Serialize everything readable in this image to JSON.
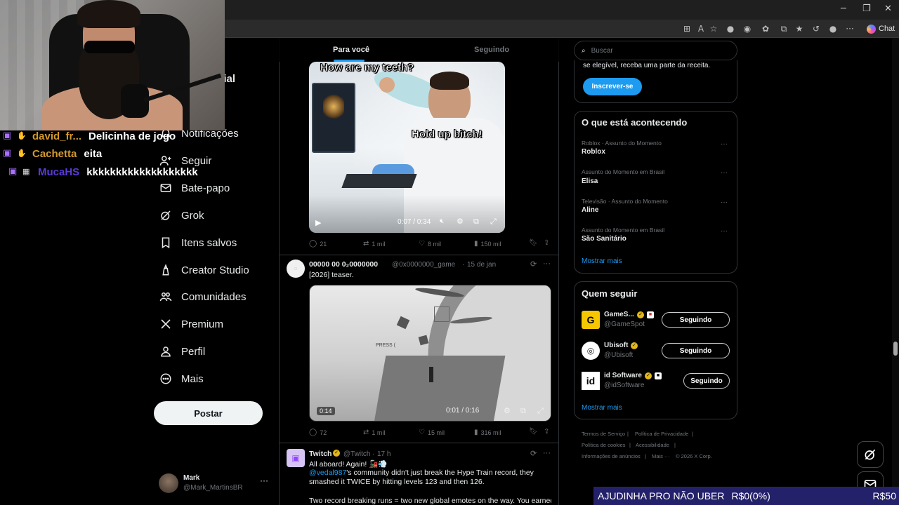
{
  "stream_overlay": {
    "chat": [
      {
        "user": "david_fr...",
        "user_color": "#d49a2f",
        "message": "Delicinha de jogo"
      },
      {
        "user": "Cachetta",
        "user_color": "#d49a2f",
        "message": "eita"
      },
      {
        "user": "MucaHS",
        "user_color": "#5b3bd9",
        "message": "kkkkkkkkkkkkkkkkkkk"
      }
    ],
    "donation_bar": {
      "label": "AJUDINHA PRO NÃO UBER",
      "current": "R$0(0%)",
      "goal": "R$50"
    }
  },
  "browser": {
    "chat_button": "Chat"
  },
  "nav": {
    "partial_item": "cial",
    "items": [
      {
        "label": "Notificações"
      },
      {
        "label": "Seguir"
      },
      {
        "label": "Bate-papo"
      },
      {
        "label": "Grok"
      },
      {
        "label": "Itens salvos"
      },
      {
        "label": "Creator Studio"
      },
      {
        "label": "Comunidades"
      },
      {
        "label": "Premium"
      },
      {
        "label": "Perfil"
      },
      {
        "label": "Mais"
      }
    ],
    "post_button": "Postar",
    "account": {
      "name": "Mark",
      "handle": "@Mark_MartinsBR"
    }
  },
  "timeline": {
    "tabs": [
      "Para você",
      "Seguindo"
    ],
    "posts": [
      {
        "meme_top": "How are my teeth?",
        "meme_bottom": "Hold up bitch!",
        "video_time": "0:07 / 0:34",
        "stats": {
          "replies": "21",
          "reposts": "1 mil",
          "likes": "8 mil",
          "views": "150 mil"
        }
      },
      {
        "author": "00000 00 0₂0000000",
        "handle": "@0x0000000_game",
        "date": "15 de jan",
        "text": "[2026] teaser.",
        "video_badge": "0:14",
        "video_time": "0:01 / 0:16",
        "scene_text": "PRESS (",
        "stats": {
          "replies": "72",
          "reposts": "1 mil",
          "likes": "15 mil",
          "views": "316 mil"
        }
      },
      {
        "author": "Twitch",
        "handle": "@Twitch",
        "time": "17 h",
        "line1": "All aboard! Again! 🚂💨",
        "mention": "@vedal987",
        "line2": "'s community didn't just break the Hype Train record, they smashed it TWICE by hitting levels 123 and then 126.",
        "line3": "Two record breaking runs = two new global emotes on the way. You earned"
      }
    ]
  },
  "sidebar": {
    "search_placeholder": "Buscar",
    "premium_text": "se elegível, receba uma parte da receita.",
    "subscribe_button": "Inscrever-se",
    "trends_title": "O que está acontecendo",
    "trends": [
      {
        "meta": "Roblox · Assunto do Momento",
        "name": "Roblox"
      },
      {
        "meta": "Assunto do Momento em Brasil",
        "name": "Elisa"
      },
      {
        "meta": "Televisão · Assunto do Momento",
        "name": "Aline"
      },
      {
        "meta": "Assunto do Momento em Brasil",
        "name": "São Sanitário"
      }
    ],
    "show_more": "Mostrar mais",
    "who_to_follow_title": "Quem seguir",
    "follow": [
      {
        "name": "GameS...",
        "handle": "@GameSpot",
        "button": "Seguindo"
      },
      {
        "name": "Ubisoft",
        "handle": "@Ubisoft",
        "button": "Seguindo"
      },
      {
        "name": "id Software",
        "handle": "@idSoftware",
        "button": "Seguindo"
      }
    ],
    "show_more_follow": "Mostrar mais",
    "footer": [
      "Termos de Serviço",
      "Política de Privacidade",
      "Política de cookies",
      "Acessibilidade",
      "Informações de anúncios",
      "Mais ···",
      "© 2026 X Corp."
    ]
  }
}
